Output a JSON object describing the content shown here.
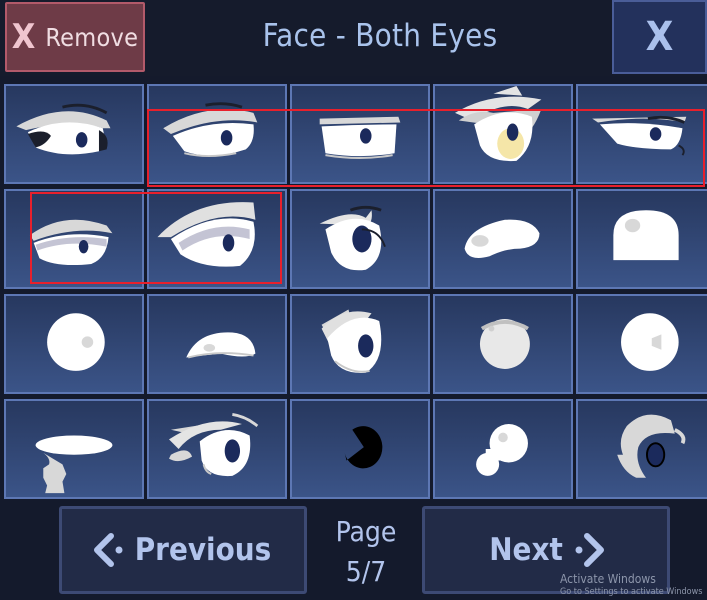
{
  "header": {
    "remove_icon": "X",
    "remove_label": "Remove",
    "title": "Face - Both Eyes",
    "close_icon": "X"
  },
  "grid": {
    "cells": [
      {
        "icon": "eye-style-1-icon"
      },
      {
        "icon": "eye-style-2-icon"
      },
      {
        "icon": "eye-style-3-icon"
      },
      {
        "icon": "eye-style-4-icon"
      },
      {
        "icon": "eye-style-5-icon"
      },
      {
        "icon": "eye-style-6-icon"
      },
      {
        "icon": "eye-style-7-icon"
      },
      {
        "icon": "eye-style-8-icon"
      },
      {
        "icon": "eye-style-9-icon"
      },
      {
        "icon": "eye-style-10-icon"
      },
      {
        "icon": "eye-style-11-icon"
      },
      {
        "icon": "eye-style-12-icon"
      },
      {
        "icon": "eye-style-13-icon"
      },
      {
        "icon": "eye-style-14-icon"
      },
      {
        "icon": "eye-style-15-icon"
      },
      {
        "icon": "eye-style-16-icon"
      },
      {
        "icon": "eye-style-17-icon"
      },
      {
        "icon": "eye-style-18-icon"
      },
      {
        "icon": "eye-style-19-icon"
      },
      {
        "icon": "eye-style-20-icon"
      }
    ]
  },
  "footer": {
    "previous_label": "Previous",
    "next_label": "Next",
    "page_label": "Page",
    "page_value": "5/7"
  },
  "watermark": {
    "line1": "Activate Windows",
    "line2": "Go to Settings to activate Windows"
  },
  "colors": {
    "cell_bg_top": "#27385f",
    "cell_bg_bottom": "#3b5488",
    "cell_border": "#5d77b4",
    "highlight": "#e8202c",
    "remove_bg": "#6e3b47",
    "title_text": "#a9c3ec"
  }
}
